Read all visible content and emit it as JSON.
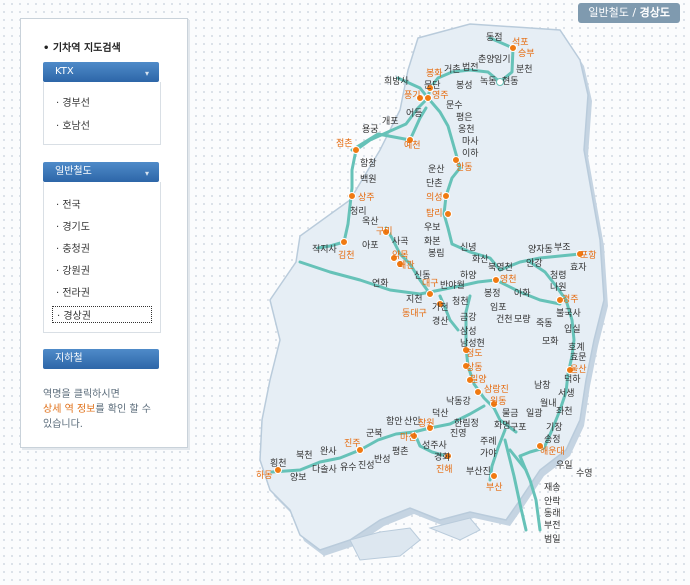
{
  "breadcrumb": {
    "general": "일반철도",
    "sep": "/",
    "current": "경상도"
  },
  "sidebar": {
    "title": "• 기차역 지도검색",
    "ktx": {
      "label": "KTX",
      "items": [
        "· 경부선",
        "· 호남선"
      ]
    },
    "general": {
      "label": "일반철도",
      "items": [
        "· 전국",
        "· 경기도",
        "· 충청권",
        "· 강원권",
        "· 전라권",
        "· 경상권"
      ]
    },
    "subway": {
      "label": "지하철"
    },
    "note_line1": "역명을 클릭하시면",
    "note_hl": "상세 역 정보",
    "note_line2": "를 확인 할 수",
    "note_line3": "있습니다."
  },
  "colors": {
    "line": "#66c2b8",
    "orange": "#f07a12",
    "sea": "#eef3f8",
    "land": "#dbe6ef"
  },
  "stations": [
    {
      "name": "동점",
      "orange": false
    },
    {
      "name": "석포",
      "orange": true
    },
    {
      "name": "승부",
      "orange": true
    },
    {
      "name": "봉화",
      "orange": true
    },
    {
      "name": "거촌",
      "orange": false
    },
    {
      "name": "법전",
      "orange": false
    },
    {
      "name": "춘양",
      "orange": false
    },
    {
      "name": "임기",
      "orange": false
    },
    {
      "name": "분천",
      "orange": false
    },
    {
      "name": "희방사",
      "orange": false
    },
    {
      "name": "문단",
      "orange": false
    },
    {
      "name": "봉성",
      "orange": false
    },
    {
      "name": "녹동",
      "orange": false
    },
    {
      "name": "현동",
      "orange": false
    },
    {
      "name": "풍기",
      "orange": true
    },
    {
      "name": "영주",
      "orange": true
    },
    {
      "name": "문수",
      "orange": false
    },
    {
      "name": "어등",
      "orange": false
    },
    {
      "name": "평은",
      "orange": false
    },
    {
      "name": "용궁",
      "orange": false
    },
    {
      "name": "개포",
      "orange": false
    },
    {
      "name": "옹천",
      "orange": false
    },
    {
      "name": "점촌",
      "orange": true
    },
    {
      "name": "예천",
      "orange": true
    },
    {
      "name": "마사",
      "orange": false
    },
    {
      "name": "이하",
      "orange": false
    },
    {
      "name": "안동",
      "orange": true
    },
    {
      "name": "함창",
      "orange": false
    },
    {
      "name": "운산",
      "orange": false
    },
    {
      "name": "백원",
      "orange": false
    },
    {
      "name": "단촌",
      "orange": false
    },
    {
      "name": "의성",
      "orange": true
    },
    {
      "name": "상주",
      "orange": true
    },
    {
      "name": "청리",
      "orange": false
    },
    {
      "name": "탑리",
      "orange": true
    },
    {
      "name": "옥산",
      "orange": false
    },
    {
      "name": "우보",
      "orange": false
    },
    {
      "name": "화본",
      "orange": false
    },
    {
      "name": "구미",
      "orange": true
    },
    {
      "name": "양자동",
      "orange": false
    },
    {
      "name": "부조",
      "orange": false
    },
    {
      "name": "신녕",
      "orange": false
    },
    {
      "name": "봉림",
      "orange": false
    },
    {
      "name": "사곡",
      "orange": false
    },
    {
      "name": "아포",
      "orange": false
    },
    {
      "name": "직지사",
      "orange": false
    },
    {
      "name": "김천",
      "orange": true
    },
    {
      "name": "화산",
      "orange": false
    },
    {
      "name": "북영천",
      "orange": false
    },
    {
      "name": "안강",
      "orange": false
    },
    {
      "name": "포항",
      "orange": true
    },
    {
      "name": "효자",
      "orange": false
    },
    {
      "name": "약목",
      "orange": true
    },
    {
      "name": "왜관",
      "orange": true
    },
    {
      "name": "청령",
      "orange": false
    },
    {
      "name": "나원",
      "orange": false
    },
    {
      "name": "신동",
      "orange": false
    },
    {
      "name": "하양",
      "orange": false
    },
    {
      "name": "영천",
      "orange": true
    },
    {
      "name": "연화",
      "orange": false
    },
    {
      "name": "대구",
      "orange": true
    },
    {
      "name": "반야월",
      "orange": false
    },
    {
      "name": "경주",
      "orange": true
    },
    {
      "name": "불국사",
      "orange": false
    },
    {
      "name": "지천",
      "orange": false
    },
    {
      "name": "가천",
      "orange": false
    },
    {
      "name": "동대구",
      "orange": true
    },
    {
      "name": "청천",
      "orange": false
    },
    {
      "name": "경산",
      "orange": false
    },
    {
      "name": "금강",
      "orange": false
    },
    {
      "name": "임포",
      "orange": false
    },
    {
      "name": "건천",
      "orange": false
    },
    {
      "name": "봉정",
      "orange": false
    },
    {
      "name": "아화",
      "orange": false
    },
    {
      "name": "모량",
      "orange": false
    },
    {
      "name": "죽동",
      "orange": false
    },
    {
      "name": "입실",
      "orange": false
    },
    {
      "name": "삼성",
      "orange": false
    },
    {
      "name": "남성현",
      "orange": false
    },
    {
      "name": "모화",
      "orange": false
    },
    {
      "name": "호계",
      "orange": false
    },
    {
      "name": "효문",
      "orange": false
    },
    {
      "name": "청도",
      "orange": true
    },
    {
      "name": "울산",
      "orange": true
    },
    {
      "name": "상동",
      "orange": true
    },
    {
      "name": "덕하",
      "orange": false
    },
    {
      "name": "밀양",
      "orange": true
    },
    {
      "name": "남창",
      "orange": false
    },
    {
      "name": "삼랑진",
      "orange": true
    },
    {
      "name": "서생",
      "orange": false
    },
    {
      "name": "낙동강",
      "orange": false
    },
    {
      "name": "원동",
      "orange": true
    },
    {
      "name": "월내",
      "orange": false
    },
    {
      "name": "물금",
      "orange": false
    },
    {
      "name": "일광",
      "orange": false
    },
    {
      "name": "좌천",
      "orange": false
    },
    {
      "name": "덕산",
      "orange": false
    },
    {
      "name": "화명",
      "orange": false
    },
    {
      "name": "함안",
      "orange": false
    },
    {
      "name": "산인",
      "orange": false
    },
    {
      "name": "창원",
      "orange": true
    },
    {
      "name": "구포",
      "orange": false
    },
    {
      "name": "한림정",
      "orange": false
    },
    {
      "name": "진영",
      "orange": false
    },
    {
      "name": "군북",
      "orange": false
    },
    {
      "name": "마산",
      "orange": true
    },
    {
      "name": "송정",
      "orange": false
    },
    {
      "name": "기장",
      "orange": false
    },
    {
      "name": "주례",
      "orange": false
    },
    {
      "name": "가야",
      "orange": false
    },
    {
      "name": "해운대",
      "orange": true
    },
    {
      "name": "진주",
      "orange": true
    },
    {
      "name": "완사",
      "orange": false
    },
    {
      "name": "평촌",
      "orange": false
    },
    {
      "name": "성주사",
      "orange": false
    },
    {
      "name": "반성",
      "orange": false
    },
    {
      "name": "북천",
      "orange": false
    },
    {
      "name": "횡천",
      "orange": false
    },
    {
      "name": "경화",
      "orange": false
    },
    {
      "name": "진해",
      "orange": true
    },
    {
      "name": "유수",
      "orange": false
    },
    {
      "name": "진성",
      "orange": false
    },
    {
      "name": "다솔사",
      "orange": false
    },
    {
      "name": "부산진",
      "orange": false
    },
    {
      "name": "우일",
      "orange": false
    },
    {
      "name": "하동",
      "orange": true
    },
    {
      "name": "양보",
      "orange": false
    },
    {
      "name": "부산",
      "orange": true
    },
    {
      "name": "수영",
      "orange": false
    },
    {
      "name": "재송",
      "orange": false
    },
    {
      "name": "안락",
      "orange": false
    },
    {
      "name": "동래",
      "orange": false
    },
    {
      "name": "부전",
      "orange": false
    },
    {
      "name": "범일",
      "orange": false
    }
  ]
}
